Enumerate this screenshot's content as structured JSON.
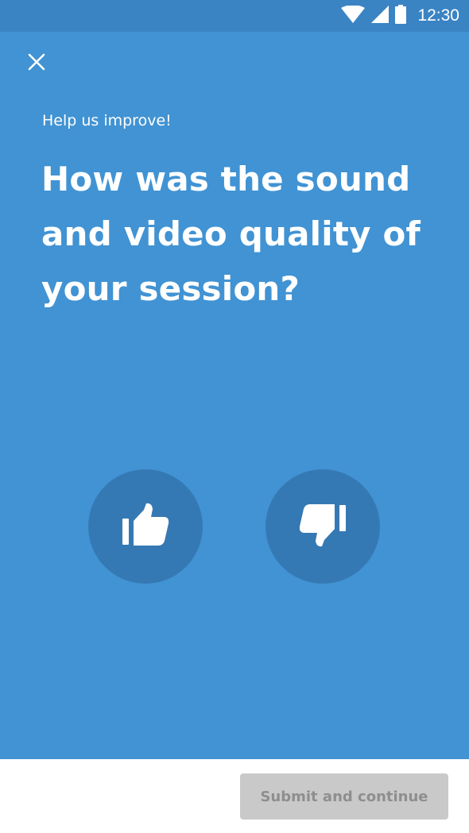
{
  "status_bar": {
    "time": "12:30",
    "icons": [
      "wifi-icon",
      "signal-icon",
      "battery-icon"
    ]
  },
  "survey": {
    "close_icon": "close-icon",
    "eyebrow": "Help us improve!",
    "question": "How was the sound and video quality of your session?",
    "options": [
      {
        "icon": "thumbs-up-icon"
      },
      {
        "icon": "thumbs-down-icon"
      }
    ]
  },
  "footer": {
    "submit_label": "Submit and continue",
    "submit_enabled": false
  },
  "colors": {
    "status_bar": "#3a84c4",
    "panel": "#4193d3",
    "button_circle": "#3579b4",
    "text": "#ffffff",
    "submit_bg": "#c9c9c9",
    "submit_text": "#8e8e8e"
  }
}
